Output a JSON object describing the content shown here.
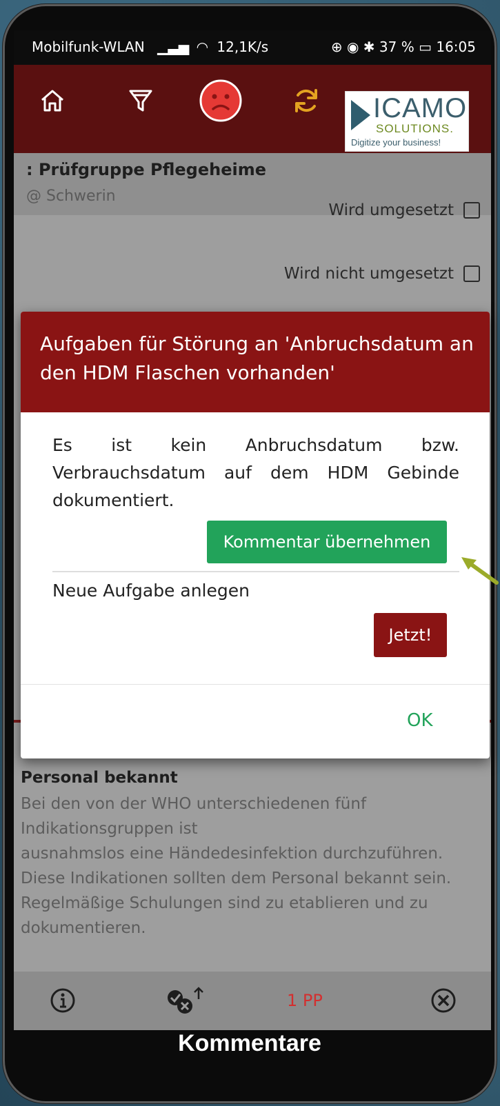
{
  "status_bar": {
    "carrier": "Mobilfunk-WLAN",
    "speed": "12,1K/s",
    "battery": "37 %",
    "time": "16:05"
  },
  "toolbar": {
    "icons": [
      "home-icon",
      "filter-icon",
      "sad-face-icon",
      "sync-icon"
    ],
    "accent_colors": {
      "header": "#5a1010",
      "sad_face": "#e53935",
      "sync": "#e3a321"
    }
  },
  "logo": {
    "name": "ICAMO",
    "sub": "SOLUTIONS.",
    "tagline": "Digitize your business!"
  },
  "group": {
    "title": ": Prüfgruppe Pflegeheime",
    "location": "@ Schwerin"
  },
  "options": {
    "implemented": "Wird umgesetzt",
    "not_implemented": "Wird nicht umgesetzt"
  },
  "background_text": {
    "personal_bekannt": "Personal bekannt",
    "paragraph_lines": [
      "Bei den von der WHO unterschiedenen fünf",
      "Indikationsgruppen ist",
      "ausnahmslos eine Händedesinfektion durchzuführen.",
      "Diese Indikationen sollten dem Personal bekannt sein.",
      "Regelmäßige Schulungen sind zu etablieren und zu",
      "dokumentieren."
    ]
  },
  "modal": {
    "title": "Aufgaben für Störung an 'Anbruchsdatum an den HDM Flaschen vorhanden'",
    "text": "Es ist kein Anbruchsdatum bzw. Verbrauchsdatum auf dem HDM Gebinde dokumentiert.",
    "apply_comment_label": "Kommentar übernehmen",
    "new_task_label": "Neue Aufgabe anlegen",
    "now_label": "Jetzt!",
    "ok_label": "OK",
    "colors": {
      "header": "#8a1414",
      "green": "#22a35a"
    }
  },
  "bottom_bar": {
    "pp_label": "1 PP",
    "pp_color": "#d32f2f"
  },
  "footer": {
    "label": "Kommentare"
  }
}
